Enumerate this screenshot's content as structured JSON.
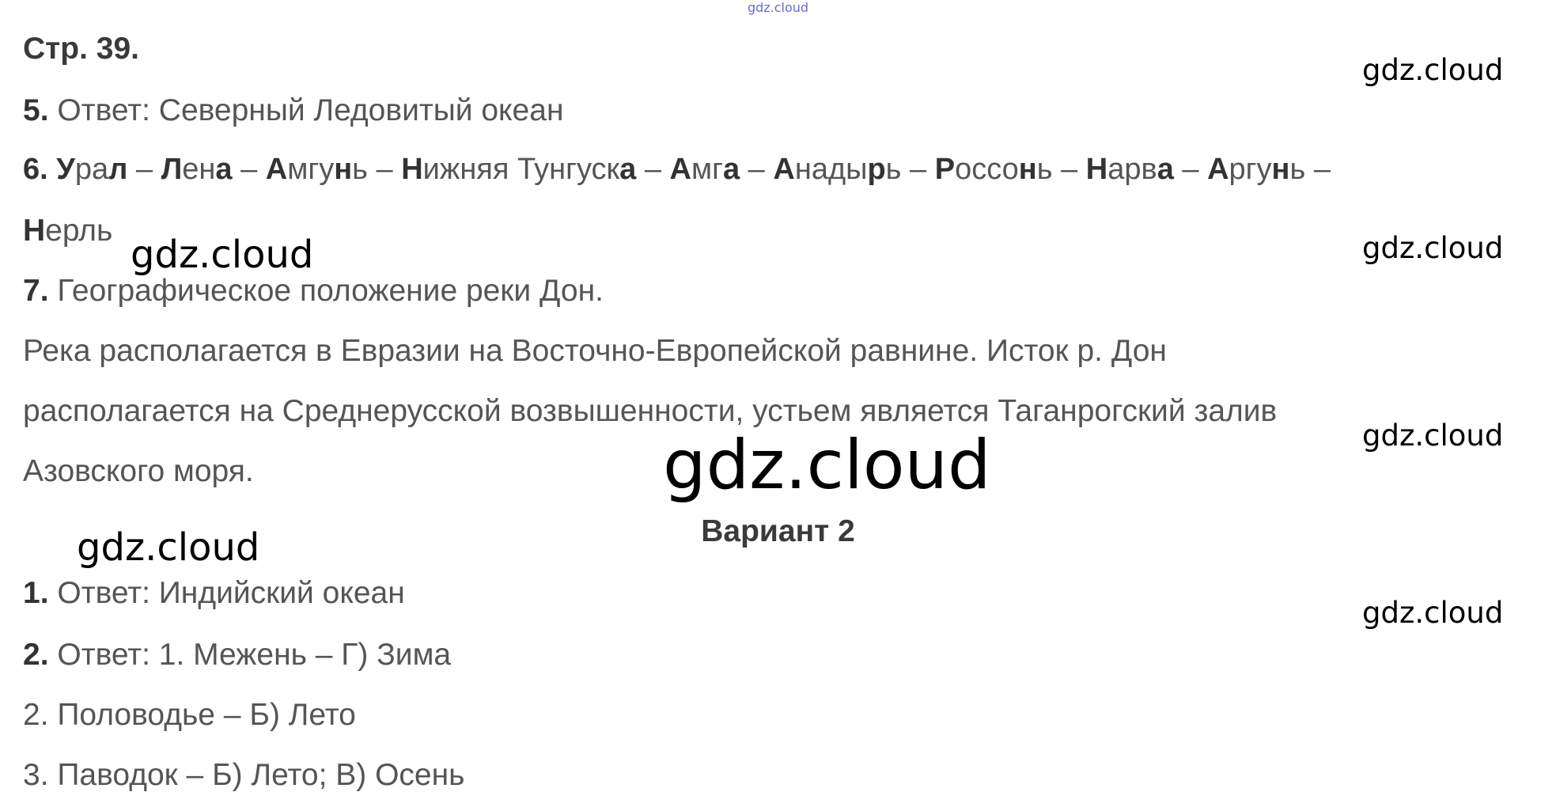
{
  "watermark": "gdz.cloud",
  "header": {
    "page_label": "Стр. 39."
  },
  "items": {
    "q5_num": "5.",
    "q5_text": " Ответ: Северный Ледовитый океан",
    "q6_num": "6.",
    "q6_parts": [
      {
        "b": "У"
      },
      {
        "n": "ра"
      },
      {
        "b": "л"
      },
      {
        "n": " – "
      },
      {
        "b": "Л"
      },
      {
        "n": "ен"
      },
      {
        "b": "а"
      },
      {
        "n": " – "
      },
      {
        "b": "А"
      },
      {
        "n": "мгу"
      },
      {
        "b": "н"
      },
      {
        "n": "ь – "
      },
      {
        "b": "Н"
      },
      {
        "n": "ижняя Тунгуск"
      },
      {
        "b": "а"
      },
      {
        "n": " – "
      },
      {
        "b": "А"
      },
      {
        "n": "мг"
      },
      {
        "b": "а"
      },
      {
        "n": " – "
      },
      {
        "b": "А"
      },
      {
        "n": "нады"
      },
      {
        "b": "р"
      },
      {
        "n": "ь – "
      },
      {
        "b": "Р"
      },
      {
        "n": "оссо"
      },
      {
        "b": "н"
      },
      {
        "n": "ь – "
      },
      {
        "b": "Н"
      },
      {
        "n": "арв"
      },
      {
        "b": "а"
      },
      {
        "n": " – "
      },
      {
        "b": "А"
      },
      {
        "n": "ргу"
      },
      {
        "b": "н"
      },
      {
        "n": "ь –"
      }
    ],
    "q6_line2_bold": "Н",
    "q6_line2_rest": "ерль",
    "q7_num": "7.",
    "q7_title": " Географическое положение реки Дон.",
    "q7_line1": "Река располагается в Евразии на Восточно-Европейской равнине. Исток р. Дон",
    "q7_line2": "располагается на Среднерусской возвышенности, устьем является Таганрогский залив",
    "q7_line3": "Азовского моря."
  },
  "variant": {
    "title": "Вариант 2",
    "a1_num": "1.",
    "a1_text": " Ответ: Индийский океан",
    "a2_num": "2.",
    "a2_text": " Ответ: 1. Межень – Г) Зима",
    "a2_line2": "2. Половодье – Б) Лето",
    "a2_line3": "3. Паводок – Б) Лето; В) Осень"
  }
}
